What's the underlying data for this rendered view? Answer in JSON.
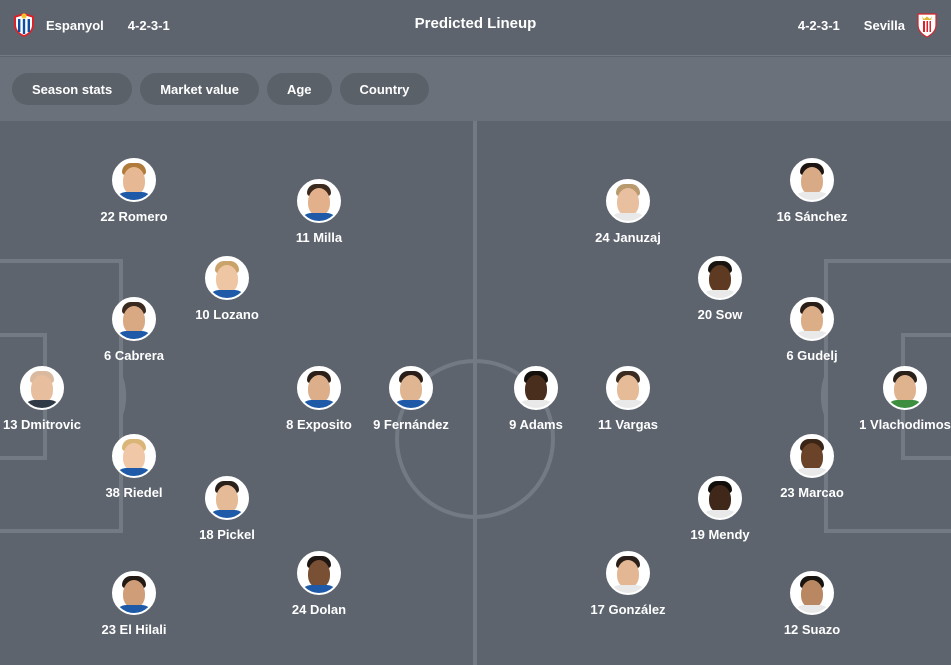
{
  "header": {
    "title": "Predicted Lineup",
    "home": {
      "name": "Espanyol",
      "formation": "4-2-3-1",
      "crest_icon": "espanyol-crest-icon"
    },
    "away": {
      "name": "Sevilla",
      "formation": "4-2-3-1",
      "crest_icon": "sevilla-crest-icon"
    }
  },
  "filters": [
    "Season stats",
    "Market value",
    "Age",
    "Country"
  ],
  "home_players": [
    {
      "label": "22 Romero"
    },
    {
      "label": "11 Milla"
    },
    {
      "label": "10 Lozano"
    },
    {
      "label": "6 Cabrera"
    },
    {
      "label": "13 Dmitrovic"
    },
    {
      "label": "8 Exposito"
    },
    {
      "label": "9 Fernández"
    },
    {
      "label": "38 Riedel"
    },
    {
      "label": "18 Pickel"
    },
    {
      "label": "24 Dolan"
    },
    {
      "label": "23 El Hilali"
    }
  ],
  "away_players": [
    {
      "label": "24 Januzaj"
    },
    {
      "label": "16 Sánchez"
    },
    {
      "label": "20 Sow"
    },
    {
      "label": "6 Gudelj"
    },
    {
      "label": "9 Adams"
    },
    {
      "label": "11 Vargas"
    },
    {
      "label": "1 Vlachodimos"
    },
    {
      "label": "23 Marcao"
    },
    {
      "label": "19 Mendy"
    },
    {
      "label": "17 González"
    },
    {
      "label": "12 Suazo"
    }
  ],
  "colors": {
    "background": "#5d646e",
    "filterbar": "#6a717b",
    "chip": "#5b6169",
    "pitch_lines": "#737a83"
  }
}
